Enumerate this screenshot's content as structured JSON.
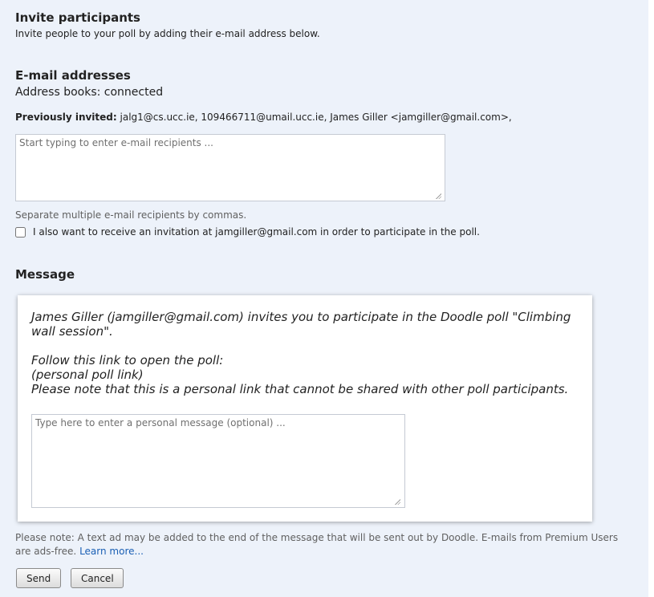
{
  "invite": {
    "title": "Invite participants",
    "description": "Invite people to your poll by adding their e-mail address below."
  },
  "emails": {
    "title": "E-mail addresses",
    "address_books": "Address books: connected",
    "previously_invited_label": "Previously invited:",
    "previously_invited_list": "jalg1@cs.ucc.ie, 109466711@umail.ucc.ie, James Giller <jamgiller@gmail.com>,",
    "recipients_value": "",
    "recipients_placeholder": "Start typing to enter e-mail recipients ...",
    "hint": "Separate multiple e-mail recipients by commas.",
    "self_invite_checked": false,
    "self_invite_label": "I also want to receive an invitation at jamgiller@gmail.com in order to participate in the poll."
  },
  "message": {
    "title": "Message",
    "line1": "James Giller (jamgiller@gmail.com) invites you to participate in the Doodle poll \"Climbing wall session\".",
    "line2": "Follow this link to open the poll:",
    "line3": "(personal poll link)",
    "line4": "Please note that this is a personal link that cannot be shared with other poll participants.",
    "personal_value": "",
    "personal_placeholder": "Type here to enter a personal message (optional) ..."
  },
  "note": {
    "text": "Please note: A text ad may be added to the end of the message that will be sent out by Doodle. E-mails from Premium Users are ads-free. ",
    "link": "Learn more..."
  },
  "actions": {
    "send_label": "Send",
    "cancel_label": "Cancel"
  },
  "colors": {
    "panel_bg": "#edf2fa",
    "link": "#1a5fb4",
    "muted_text": "#606060"
  },
  "icons": {
    "resize_grip": "resize-grip-icon"
  }
}
